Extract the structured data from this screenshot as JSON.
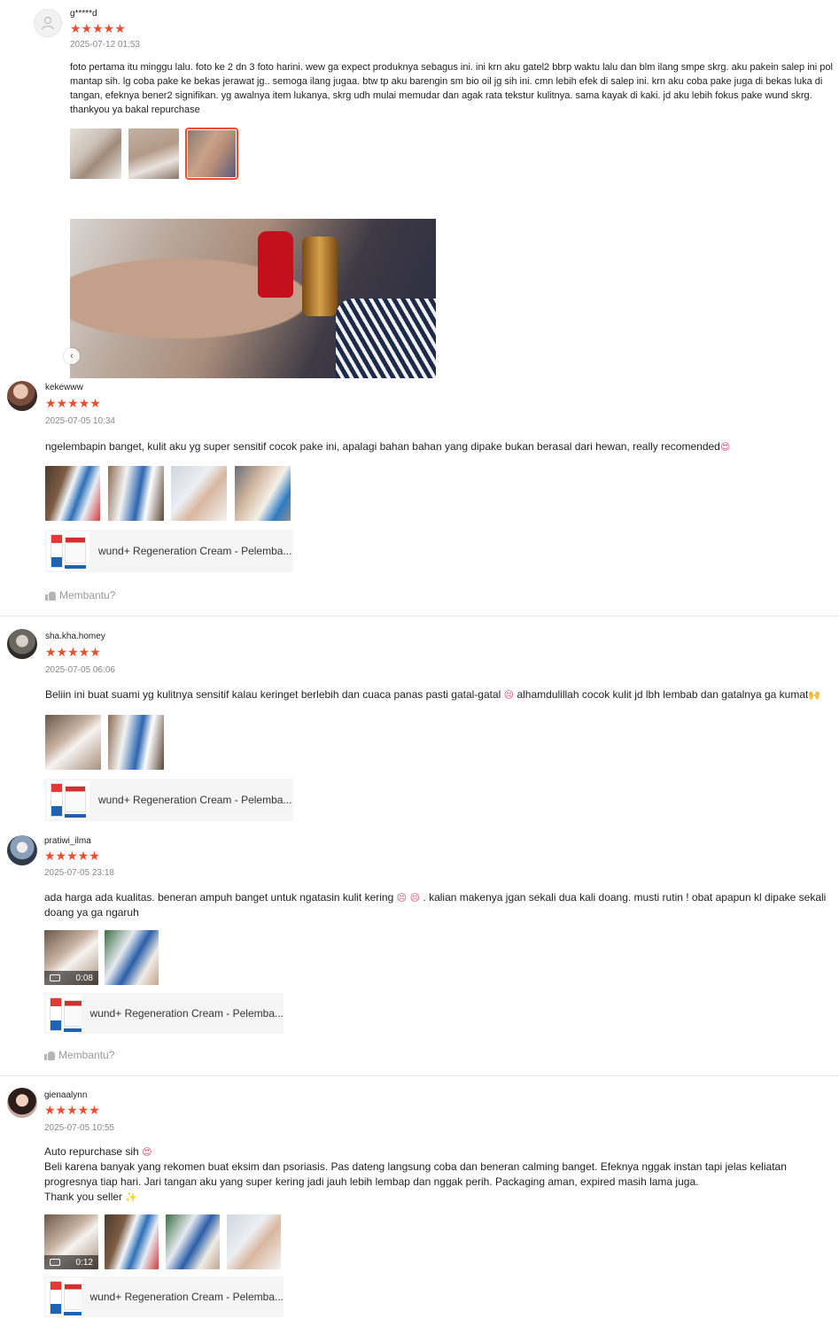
{
  "reviews": [
    {
      "username": "g*****d",
      "stars": "★★★★★",
      "date": "2025-07-12 01:53",
      "text": "foto pertama itu minggu lalu. foto ke 2 dn 3 foto harini. wew ga expect produknya sebagus ini. ini krn aku gatel2 bbrp waktu lalu dan blm ilang smpe skrg. aku pakein salep ini pol mantap sih. lg coba pake ke bekas jerawat jg.. semoga ilang jugaa. btw tp aku barengin sm bio oil jg sih ini. cmn lebih efek di salep ini. krn aku coba pake juga di bekas luka di tangan, efeknya bener2 signifikan. yg awalnya item lukanya, skrg udh mulai memudar dan agak rata tekstur kulitnya. sama kayak di kaki. jd aku lebih fokus pake wund skrg. thankyou ya bakal repurchase"
    },
    {
      "username": "kekewww",
      "stars": "★★★★★",
      "date": "2025-07-05 10:34",
      "text": "ngelembapin banget, kulit aku yg super sensitif cocok pake ini, apalagi bahan bahan yang dipake bukan berasal dari hewan, really recomended",
      "product": "wund+ Regeneration Cream - Pelemba...",
      "helpful": "Membantu?"
    },
    {
      "username": "sha.kha.homey",
      "stars": "★★★★★",
      "date": "2025-07-05 06:06",
      "text": "Beliin ini buat suami yg kulitnya sensitif kalau keringet berlebih dan cuaca panas pasti gatal-gatal",
      "text2": "alhamdulillah cocok kulit jd lbh lembab dan gatalnya ga kumat",
      "product": "wund+ Regeneration Cream - Pelemba..."
    },
    {
      "username": "pratiwi_ilma",
      "stars": "★★★★★",
      "date": "2025-07-05 23:18",
      "text": "ada harga ada kualitas. beneran ampuh banget untuk ngatasin kulit kering",
      "text2": ". kalian makenya jgan sekali dua kali doang. musti rutin ! obat apapun kl dipake sekali doang ya ga ngaruh",
      "video_time": "0:08",
      "product": "wund+ Regeneration Cream - Pelemba...",
      "helpful": "Membantu?"
    },
    {
      "username": "gienaalynn",
      "stars": "★★★★★",
      "date": "2025-07-05 10:55",
      "line1": "Auto repurchase sih",
      "text": "Beli karena banyak yang rekomen buat eksim dan psoriasis. Pas dateng langsung coba dan beneran calming banget. Efeknya nggak instan tapi jelas keliatan progresnya tiap hari. Jari tangan aku yang super kering jadi jauh lebih lembap dan nggak perih. Packaging aman, expired masih lama juga.",
      "line3": "Thank you seller",
      "video_time": "0:12",
      "product": "wund+ Regeneration Cream - Pelemba..."
    }
  ],
  "icons": {
    "default_avatar": "user-silhouette-icon",
    "prev": "chevron-left-icon",
    "helpful": "thumbs-up-icon",
    "video": "video-camera-icon"
  },
  "colors": {
    "star": "#ee4d2d",
    "selected_border": "#ee4d2d",
    "muted": "#888888"
  }
}
